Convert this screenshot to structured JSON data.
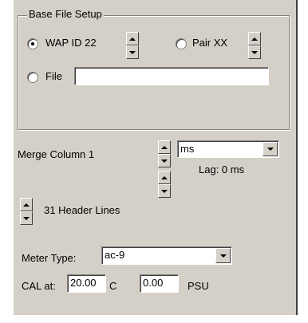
{
  "group": {
    "title": "Base File Setup"
  },
  "wap": {
    "label": "WAP ID 22",
    "selected": true
  },
  "pair": {
    "label": "Pair XX",
    "selected": false
  },
  "file": {
    "label": "File",
    "value": "",
    "selected": false
  },
  "merge": {
    "label": "Merge Column  1",
    "unit_value": "ms",
    "lag_label": "Lag:  0 ms"
  },
  "header": {
    "label": "31 Header Lines"
  },
  "meter": {
    "label": "Meter Type:",
    "value": "ac-9"
  },
  "cal": {
    "label": "CAL at:",
    "temp_value": "20.00",
    "temp_unit": "C",
    "sal_value": "0.00",
    "sal_unit": "PSU"
  },
  "icons": {
    "up": "arrow-up-icon",
    "down": "arrow-down-icon",
    "dropdown": "chevron-down-icon"
  }
}
